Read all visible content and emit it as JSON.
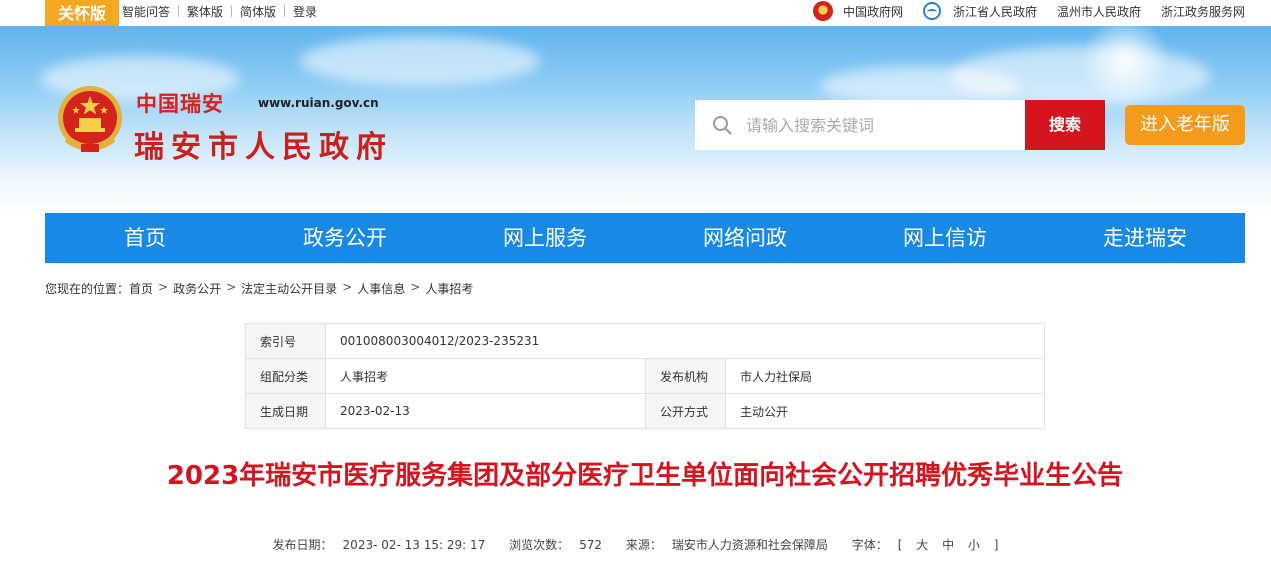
{
  "topbar": {
    "guanhuai_label": "关怀版",
    "links": [
      "智能问答",
      "繁体版",
      "简体版",
      "登录"
    ],
    "right_links": [
      "中国政府网",
      "浙江省人民政府",
      "温州市人民政府",
      "浙江政务服务网"
    ]
  },
  "header": {
    "site_name_small": "中国瑞安",
    "site_url": "www.ruian.gov.cn",
    "site_name_big": "瑞安市人民政府",
    "search_placeholder": "请输入搜索关键词",
    "search_button": "搜索",
    "elder_button": "进入老年版"
  },
  "nav": {
    "items": [
      "首页",
      "政务公开",
      "网上服务",
      "网络问政",
      "网上信访",
      "走进瑞安"
    ]
  },
  "breadcrumb": {
    "prefix": "您现在的位置：",
    "items": [
      "首页",
      "政务公开",
      "法定主动公开目录",
      "人事信息",
      "人事招考"
    ],
    "sep": ">"
  },
  "info": {
    "index_label": "索引号",
    "index_value": "001008003004012/2023-235231",
    "category_label": "组配分类",
    "category_value": "人事招考",
    "org_label": "发布机构",
    "org_value": "市人力社保局",
    "date_label": "生成日期",
    "date_value": "2023-02-13",
    "mode_label": "公开方式",
    "mode_value": "主动公开"
  },
  "article": {
    "title": "2023年瑞安市医疗服务集团及部分医疗卫生单位面向社会公开招聘优秀毕业生公告",
    "publish_label": "发布日期：",
    "publish_value": "2023- 02- 13 15: 29: 17",
    "views_label": "浏览次数：",
    "views_value": "572",
    "source_label": "来源：",
    "source_value": "瑞安市人力资源和社会保障局",
    "font_label": "字体：",
    "font_open": "[",
    "font_big": "大",
    "font_mid": "中",
    "font_small": "小",
    "font_close": "]"
  },
  "colors": {
    "nav_blue": "#1989e6",
    "search_red": "#d4141f",
    "elder_orange": "#f59a1b",
    "title_red": "#d4141f"
  }
}
